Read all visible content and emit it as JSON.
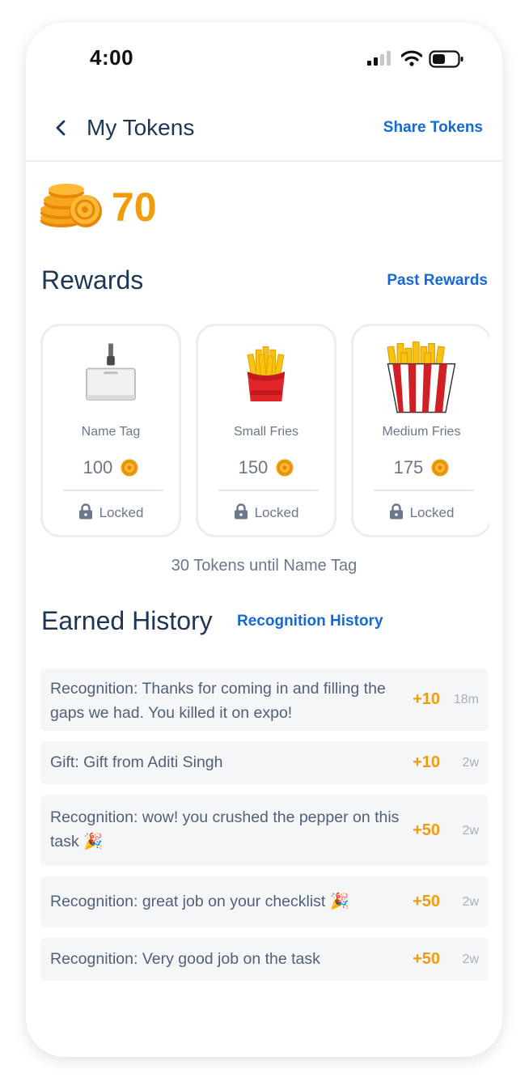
{
  "status_bar": {
    "time": "4:00"
  },
  "header": {
    "title": "My Tokens",
    "share_label": "Share Tokens",
    "back_icon": "chevron-left-icon"
  },
  "balance": {
    "value": "70",
    "icon": "coin-stack-icon",
    "color": "#f39c0b"
  },
  "rewards": {
    "title": "Rewards",
    "past_label": "Past Rewards",
    "items": [
      {
        "name": "Name Tag",
        "cost": "100",
        "status": "Locked",
        "icon": "name-tag-icon"
      },
      {
        "name": "Small Fries",
        "cost": "150",
        "status": "Locked",
        "icon": "small-fries-icon"
      },
      {
        "name": "Medium Fries",
        "cost": "175",
        "status": "Locked",
        "icon": "medium-fries-icon"
      }
    ],
    "progress_text": "30 Tokens until Name Tag"
  },
  "history": {
    "title": "Earned History",
    "recognition_label": "Recognition History",
    "items": [
      {
        "text": "Recognition:  Thanks for coming in and filling the gaps we had. You killed it on expo!",
        "points": "+10",
        "ago": "18m"
      },
      {
        "text": "Gift:  Gift from Aditi Singh",
        "points": "+10",
        "ago": "2w"
      },
      {
        "text": "Recognition:  wow! you crushed the pepper on this task 🎉",
        "points": "+50",
        "ago": "2w"
      },
      {
        "text": "Recognition:  great job on your checklist 🎉",
        "points": "+50",
        "ago": "2w"
      },
      {
        "text": "Recognition:  Very good job on the task",
        "points": "+50",
        "ago": "2w"
      }
    ]
  },
  "colors": {
    "accent": "#1469d6",
    "token": "#f39c0b",
    "text": "#1e3556"
  }
}
